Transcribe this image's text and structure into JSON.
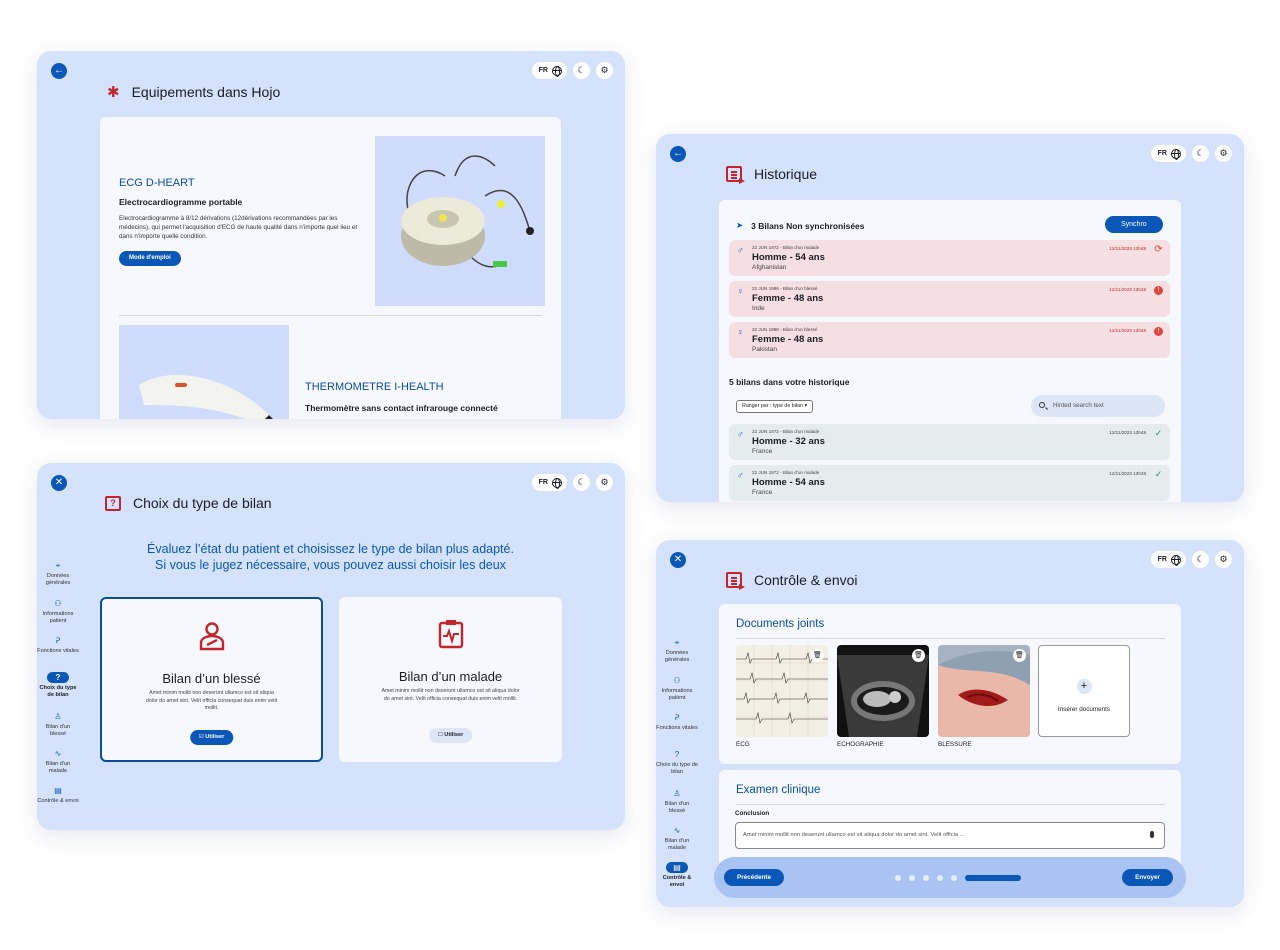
{
  "common": {
    "lang": "FR"
  },
  "equipements": {
    "title": "Equipements dans Hojo",
    "items": [
      {
        "name": "ECG D-HEART",
        "subtitle": "Electrocardiogramme portable",
        "description": "Electrocardiogramme à 8/12 dérivations (12dérivations recommandées par les médecins), qui permet l'acquisition d'ECG de haute qualité dans n'importe quel lieu et dans n'importe quelle condition.",
        "button": "Mode d'emploi"
      },
      {
        "name": "THERMOMETRE I-HEALTH",
        "subtitle": "Thermomètre sans contact infrarouge connecté"
      }
    ]
  },
  "historique": {
    "title": "Historique",
    "unsynced_title": "3 Bilans Non synchronisées",
    "sync_button": "Synchro",
    "unsynced": [
      {
        "sex": "♂",
        "meta": "22 JUN 1972 - Bilan d'un malade",
        "name": "Homme - 54 ans",
        "country": "Afghanistan",
        "date": "12/11/2023 13h48",
        "status": "sync"
      },
      {
        "sex": "♀",
        "meta": "22 JUN 1996 - Bilan d'un blessé",
        "name": "Femme - 48 ans",
        "country": "Inde",
        "date": "12/11/2023 13h48",
        "status": "warn"
      },
      {
        "sex": "♀",
        "meta": "22 JUN 1996 - Bilan d'un blessé",
        "name": "Femme - 48 ans",
        "country": "Pakistan",
        "date": "12/11/2023 13h48",
        "status": "warn"
      }
    ],
    "history_title": "5 bilans dans votre historique",
    "sort_label": "Ranger par : type de bilan",
    "search_placeholder": "Hinted search text",
    "history": [
      {
        "sex": "♂",
        "meta": "22 JUN 1972 - Bilan d'un malade",
        "name": "Homme - 32 ans",
        "country": "France",
        "date": "12/11/2023 13h48",
        "status": "ok"
      },
      {
        "sex": "♂",
        "meta": "22 JUN 1972 - Bilan d'un malade",
        "name": "Homme - 54 ans",
        "country": "France",
        "date": "12/11/2023 13h48",
        "status": "ok"
      }
    ]
  },
  "sidebar": {
    "items": [
      {
        "label": "Données générales",
        "icon": "pin-plus-icon"
      },
      {
        "label": "Informations patient",
        "icon": "user-icon"
      },
      {
        "label": "Fonctions vitales",
        "icon": "stethoscope-icon"
      },
      {
        "label": "Choix du type de bilan",
        "icon": "question-doc-icon"
      },
      {
        "label": "Bilan d'un blessé",
        "icon": "injured-user-icon"
      },
      {
        "label": "Bilan d'un malade",
        "icon": "pulse-icon"
      },
      {
        "label": "Contrôle & envoi",
        "icon": "send-doc-icon"
      }
    ]
  },
  "choix": {
    "title": "Choix du type de bilan",
    "headline_1": "Évaluez l’état du patient et choisissez le type de bilan plus adapté.",
    "headline_2": "Si vous le jugez nécessaire, vous pouvez aussi choisir les deux",
    "options": [
      {
        "title": "Bilan d’un blessé",
        "description": "Amet minim mollit non deserunt ullamco est sit aliqua dolor do amet sint. Velit officia consequat duis enim velit mollit.",
        "button": "Utiliser",
        "selected": true
      },
      {
        "title": "Bilan d’un malade",
        "description": "Amet minim mollit non deserunt ullamco est sit aliqua dolor do amet sint. Velit officia consequat duis enim velit mollit.",
        "button": "Utiliser",
        "selected": false
      }
    ]
  },
  "controle": {
    "title": "Contrôle & envoi",
    "docs_title": "Documents joints",
    "docs": [
      {
        "label": "ECG"
      },
      {
        "label": "ECHOGRAPHIE"
      },
      {
        "label": "BLESSURE"
      }
    ],
    "add_doc": "Insérer documents",
    "exam_title": "Examen clinique",
    "conclusion_label": "Conclusion",
    "conclusion_value": "Amet minim mollit non deserunt ullamco est sit aliqua dolor do amet sint. Velit officia ...",
    "prev_button": "Précédente",
    "next_button": "Envoyer",
    "progress": {
      "current_step": 6,
      "total_steps": 6
    }
  },
  "colors": {
    "accent": "#0a57b8",
    "brand_red": "#c0262b",
    "panel_bg": "#d5e2fb"
  }
}
